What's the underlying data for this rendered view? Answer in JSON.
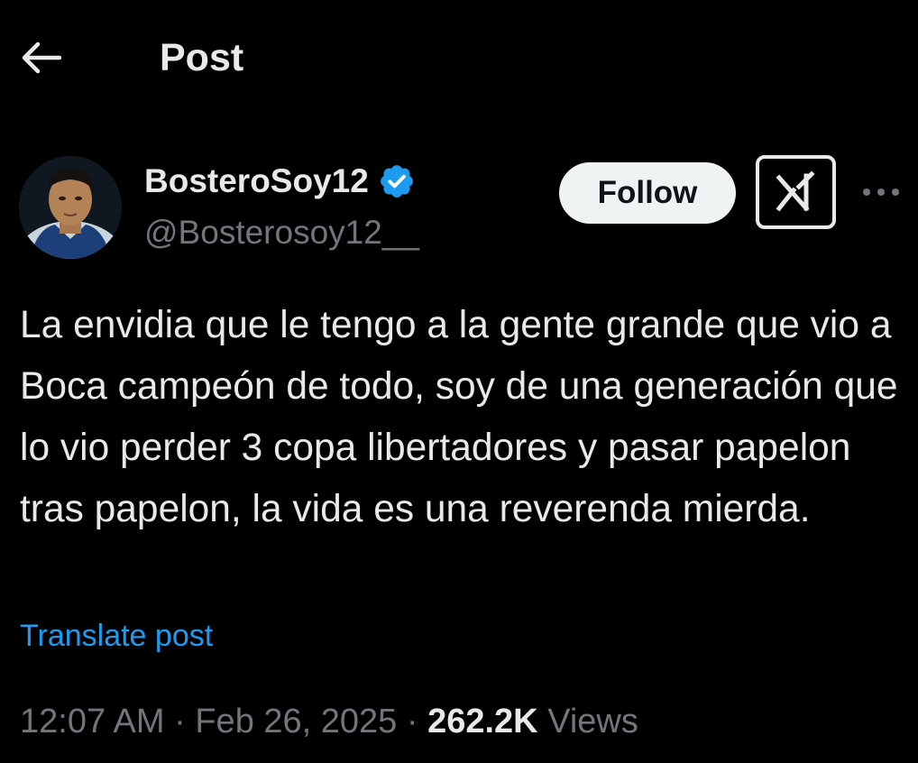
{
  "header": {
    "title": "Post",
    "back_icon": "arrow-left-icon"
  },
  "author": {
    "display_name": "BosteroSoy12",
    "handle": "@Bosterosoy12__",
    "verified_icon": "verified-badge-icon",
    "verified_color": "#1d9bf0",
    "follow_label": "Follow",
    "grok_icon": "grok-icon",
    "more_icon": "more-horizontal-icon"
  },
  "post": {
    "text": "La envidia que le tengo a la gente grande que vio a Boca campeón de todo, soy de una generación que lo vio perder 3 copa libertadores y pasar papelon tras papelon, la vida es una reverenda mierda.",
    "translate_label": "Translate post"
  },
  "meta": {
    "time": "12:07 AM",
    "separator": " · ",
    "date": "Feb 26, 2025",
    "views_count": "262.2K",
    "views_label": " Views"
  },
  "colors": {
    "background": "#000000",
    "text_primary": "#e7e9ea",
    "text_secondary": "#71767b",
    "link": "#1d9bf0",
    "follow_bg": "#eff3f4"
  }
}
